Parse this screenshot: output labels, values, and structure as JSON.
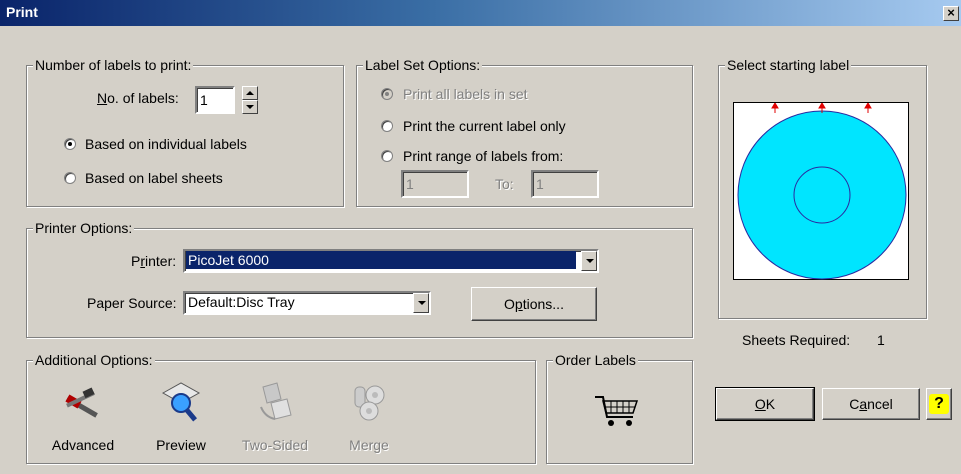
{
  "window": {
    "title": "Print",
    "close_glyph": "×"
  },
  "labels_to_print": {
    "legend": "Number of labels to print:",
    "no_labels_label_prefix": "N",
    "no_labels_label_rest": "o. of labels:",
    "no_labels_value": "1",
    "radio_individual": "Based on individual labels",
    "radio_sheets": "Based on label sheets"
  },
  "label_set": {
    "legend": "Label Set Options:",
    "radio_all": "Print all labels in set",
    "radio_current": "Print the current label only",
    "radio_range": "Print range of labels from:",
    "from_value": "1",
    "to_label": "To:",
    "to_value": "1"
  },
  "printer_options": {
    "legend": "Printer Options:",
    "printer_label_pre": "P",
    "printer_label_u": "r",
    "printer_label_post": "inter:",
    "printer_value": "PicoJet 6000",
    "paper_label": "Paper Source:",
    "paper_value": "Default:Disc Tray",
    "options_pre": "O",
    "options_u": "p",
    "options_post": "tions..."
  },
  "additional": {
    "legend": "Additional Options:",
    "advanced": "Advanced",
    "preview": "Preview",
    "two_sided": "Two-Sided",
    "merge": "Merge"
  },
  "order": {
    "legend": "Order Labels"
  },
  "starting_label": {
    "legend": "Select starting label",
    "sheets_label": "Sheets Required:",
    "sheets_value": "1"
  },
  "buttons": {
    "ok_u": "O",
    "ok_rest": "K",
    "cancel_pre": "C",
    "cancel_u": "a",
    "cancel_rest": "ncel",
    "help_glyph": "?"
  },
  "colors": {
    "disc": "#00e5ff",
    "disc_outline": "#2a2aa0",
    "arrows": "#e00000",
    "selection": "#0a246a",
    "help_yellow": "#ffff00"
  }
}
